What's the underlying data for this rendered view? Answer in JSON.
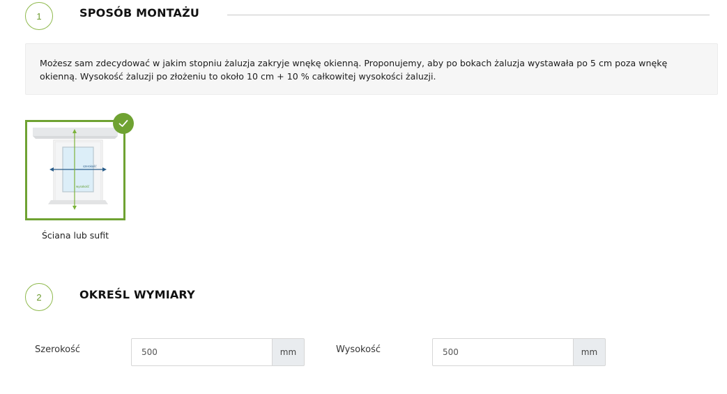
{
  "step1": {
    "number": "1",
    "title": "SPOSÓB MONTAŻU",
    "info_text": "Możesz sam zdecydować w jakim stopniu żaluzja zakryje wnękę okienną. Proponujemy, aby po bokach żaluzja wystawała po 5 cm poza wnękę okienną. Wysokość żaluzji po złożeniu to około 10 cm + 10 % całkowitej wysokości żaluzji.",
    "options": [
      {
        "label": "Ściana lub sufit",
        "selected": true,
        "image_icon": "window-mount-icon",
        "image_labels": {
          "width": "szerokość",
          "height": "wysokość"
        }
      }
    ]
  },
  "step2": {
    "number": "2",
    "title": "OKREŚL WYMIARY",
    "width_field": {
      "label": "Szerokość",
      "value": "500",
      "unit": "mm"
    },
    "height_field": {
      "label": "Wysokość",
      "value": "500",
      "unit": "mm"
    }
  },
  "colors": {
    "accent_green": "#6fa232",
    "circle_border": "#8db84a",
    "info_bg": "#f6f6f6",
    "unit_bg": "#e9ecef"
  }
}
